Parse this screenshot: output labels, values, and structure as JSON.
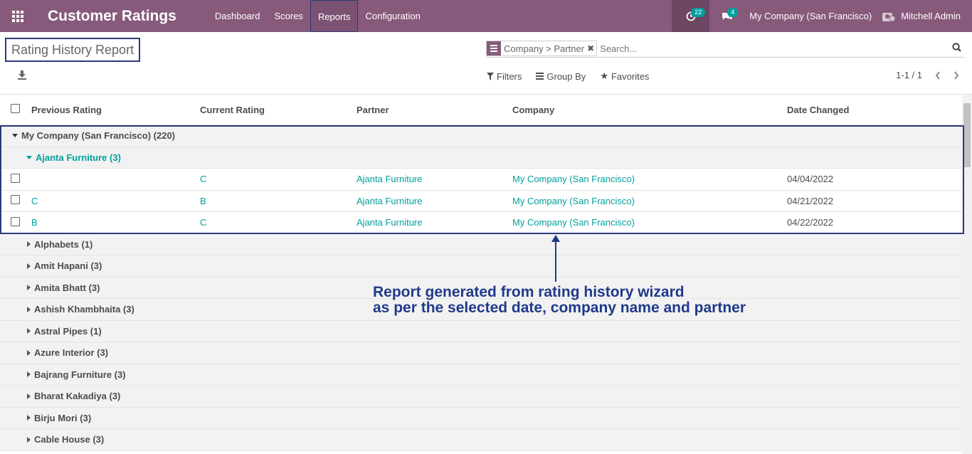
{
  "navbar": {
    "app_title": "Customer Ratings",
    "menu": [
      "Dashboard",
      "Scores",
      "Reports",
      "Configuration"
    ],
    "activity_count": "22",
    "message_count": "4",
    "company": "My Company (San Francisco)",
    "user": "Mitchell Admin"
  },
  "control_panel": {
    "breadcrumb": "Rating History Report",
    "search": {
      "facet": "Company > Partner",
      "placeholder": "Search..."
    },
    "filters_label": "Filters",
    "group_by_label": "Group By",
    "favorites_label": "Favorites",
    "pager": "1-1 / 1"
  },
  "table": {
    "headers": [
      "Previous Rating",
      "Current Rating",
      "Partner",
      "Company",
      "Date Changed"
    ],
    "top_group": "My Company (San Francisco) (220)",
    "sub_group": "Ajanta Furniture (3)",
    "rows": [
      {
        "prev": "",
        "cur": "C",
        "partner": "Ajanta Furniture",
        "company": "My Company (San Francisco)",
        "date": "04/04/2022"
      },
      {
        "prev": "C",
        "cur": "B",
        "partner": "Ajanta Furniture",
        "company": "My Company (San Francisco)",
        "date": "04/21/2022"
      },
      {
        "prev": "B",
        "cur": "C",
        "partner": "Ajanta Furniture",
        "company": "My Company (San Francisco)",
        "date": "04/22/2022"
      }
    ],
    "collapsed_groups": [
      "Alphabets (1)",
      "Amit Hapani (3)",
      "Amita Bhatt (3)",
      "Ashish Khambhaita (3)",
      "Astral Pipes (1)",
      "Azure Interior (3)",
      "Bajrang Furniture (3)",
      "Bharat Kakadiya (3)",
      "Birju Mori (3)",
      "Cable House (3)"
    ]
  },
  "annotation": {
    "line1": "Report generated from rating history wizard",
    "line2": "as per the selected date, company name and partner"
  },
  "colors": {
    "navbar": "#875a7b",
    "accent": "#00a09d",
    "annotation": "#1f3a8a"
  }
}
